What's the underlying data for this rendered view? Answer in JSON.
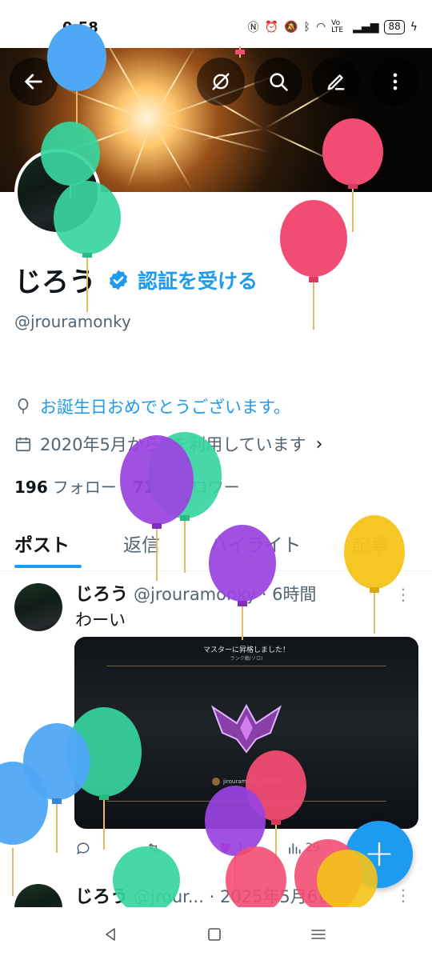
{
  "status_bar": {
    "time": "0:58",
    "battery": "88",
    "network": "Vo LTE"
  },
  "header": {
    "back_icon": "arrow-left-icon",
    "action_icons": [
      "hide-icon",
      "search-icon",
      "edit-icon",
      "more-vertical-icon"
    ]
  },
  "profile": {
    "display_name": "じろう",
    "verify_link": "認証を受ける",
    "handle": "@jrouramonky",
    "birthday_text": "お誕生日おめでとうございます。",
    "joined_text": "2020年5月からXを利用しています",
    "following_count": "196",
    "following_label": "フォロー",
    "followers_count": "71",
    "followers_label": "フォロワー"
  },
  "tabs": [
    {
      "label": "ポスト",
      "active": true
    },
    {
      "label": "返信",
      "active": false
    },
    {
      "label": "ハイライト",
      "active": false
    },
    {
      "label": "記事",
      "active": false
    }
  ],
  "posts": [
    {
      "name": "じろう",
      "meta": "@jrouramonky · 6時間",
      "text": "わーい",
      "media": {
        "title": "マスターに昇格しました！",
        "subtitle": "ランク戦(ソロ)",
        "player_tag": "jirouramonky #4646"
      },
      "actions": {
        "likes": "1",
        "views": "29"
      }
    },
    {
      "name": "じろう",
      "meta": "@jrour... · 2025年5月6日"
    }
  ],
  "colors": {
    "accent": "#1d9bf0",
    "text_primary": "#0f1419",
    "text_secondary": "#536471",
    "like_pink": "#f91880"
  }
}
